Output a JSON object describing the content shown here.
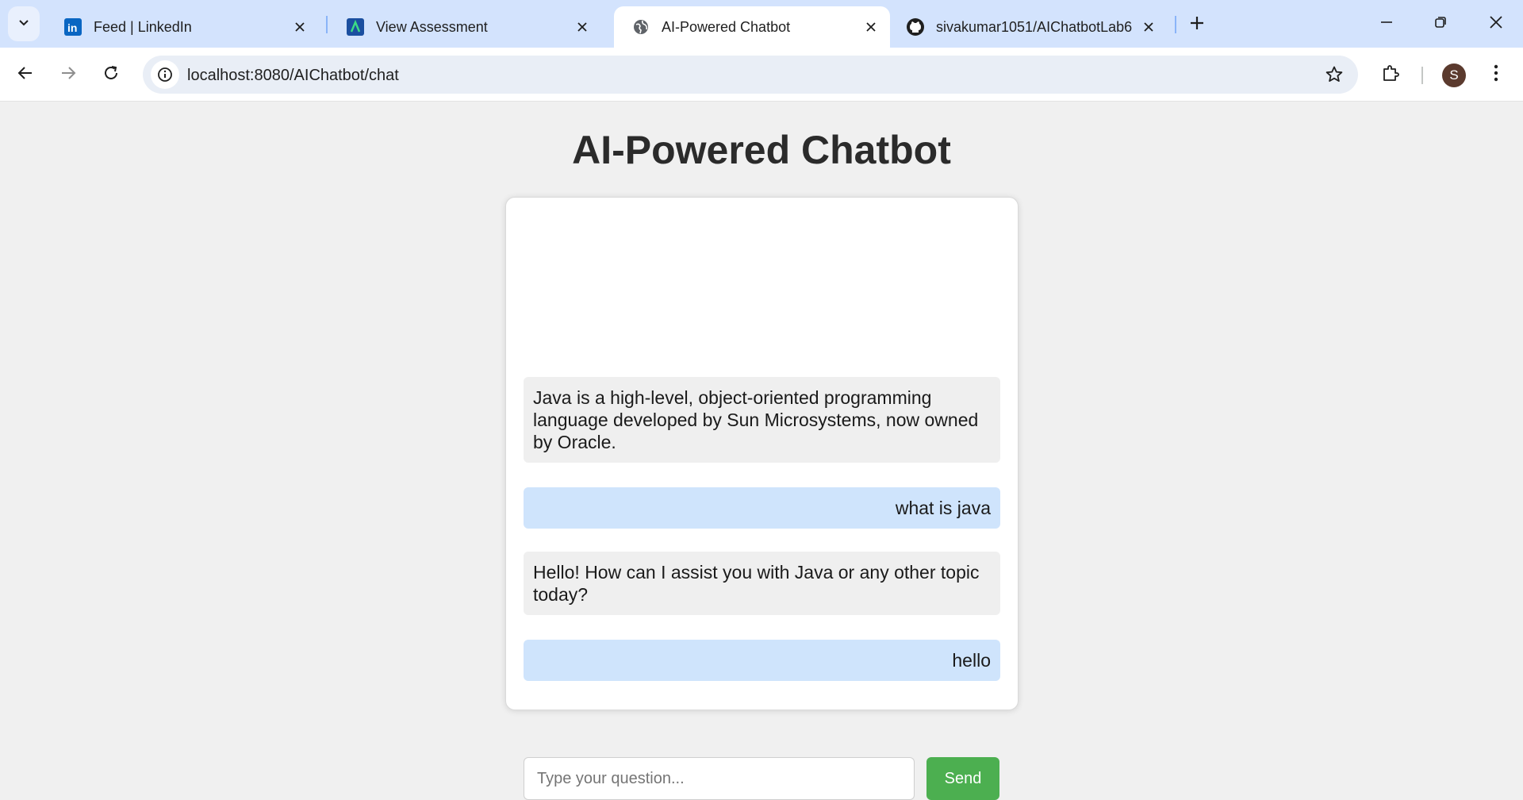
{
  "browser": {
    "tabs": [
      {
        "title": "Feed | LinkedIn",
        "icon": "linkedin-icon"
      },
      {
        "title": "View Assessment",
        "icon": "assessment-icon"
      },
      {
        "title": "AI-Powered Chatbot",
        "icon": "globe-icon",
        "active": true
      },
      {
        "title": "sivakumar1051/AIChatbotLab6",
        "icon": "github-icon"
      }
    ],
    "url": "localhost:8080/AIChatbot/chat",
    "profile_initial": "S"
  },
  "page": {
    "title": "AI-Powered Chatbot"
  },
  "chat": {
    "messages": [
      {
        "role": "bot",
        "text": "Java is a high-level, object-oriented programming language developed by Sun Microsystems, now owned by Oracle."
      },
      {
        "role": "user",
        "text": "what is java"
      },
      {
        "role": "bot",
        "text": "Hello! How can I assist you with Java or any other topic today?"
      },
      {
        "role": "user",
        "text": "hello"
      }
    ],
    "input_placeholder": "Type your question...",
    "input_value": "",
    "send_label": "Send"
  },
  "colors": {
    "tabstrip": "#d3e3fd",
    "bot_bubble": "#efefef",
    "user_bubble": "#cfe4fc",
    "send_button": "#4caf50",
    "page_background": "#f0f0f0"
  }
}
